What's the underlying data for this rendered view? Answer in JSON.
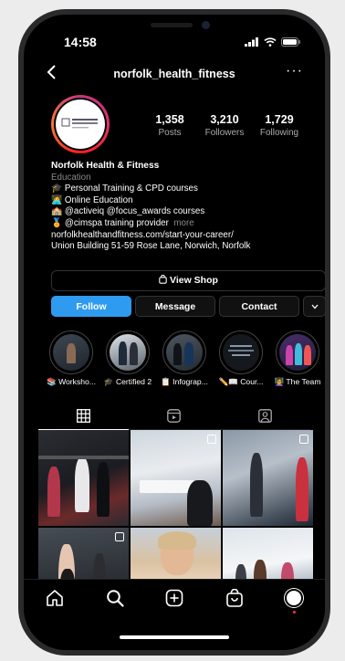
{
  "status_bar": {
    "time": "14:58"
  },
  "header": {
    "username": "norfolk_health_fitness"
  },
  "profile": {
    "stats": [
      {
        "value": "1,358",
        "label": "Posts"
      },
      {
        "value": "3,210",
        "label": "Followers"
      },
      {
        "value": "1,729",
        "label": "Following"
      }
    ],
    "name": "Norfolk Health & Fitness",
    "category": "Education",
    "bio_lines": [
      "🎓 Personal Training & CPD courses",
      "👩‍💻 Online Education",
      "🏫 @activeiq @focus_awards courses",
      "🏅 @cimspa training provider"
    ],
    "more": "more",
    "link": "norfolkhealthandfitness.com/start-your-career/",
    "address": "Union Building 51-59 Rose Lane, Norwich, Norfolk"
  },
  "actions": {
    "view_shop": "View Shop",
    "follow": "Follow",
    "message": "Message",
    "contact": "Contact"
  },
  "highlights": [
    {
      "label": "📚 Worksho..."
    },
    {
      "label": "🎓 Certified 2"
    },
    {
      "label": "📋 Infograp..."
    },
    {
      "label": "✏️📖 Cour..."
    },
    {
      "label": "👩‍🏫 The Team"
    }
  ],
  "colors": {
    "accent": "#2e9bf0",
    "background": "#000000"
  },
  "icons": {
    "tabs": [
      "grid-icon",
      "reels-icon",
      "tagged-icon"
    ],
    "nav": [
      "home-icon",
      "search-icon",
      "create-icon",
      "shop-icon",
      "profile-icon"
    ]
  }
}
